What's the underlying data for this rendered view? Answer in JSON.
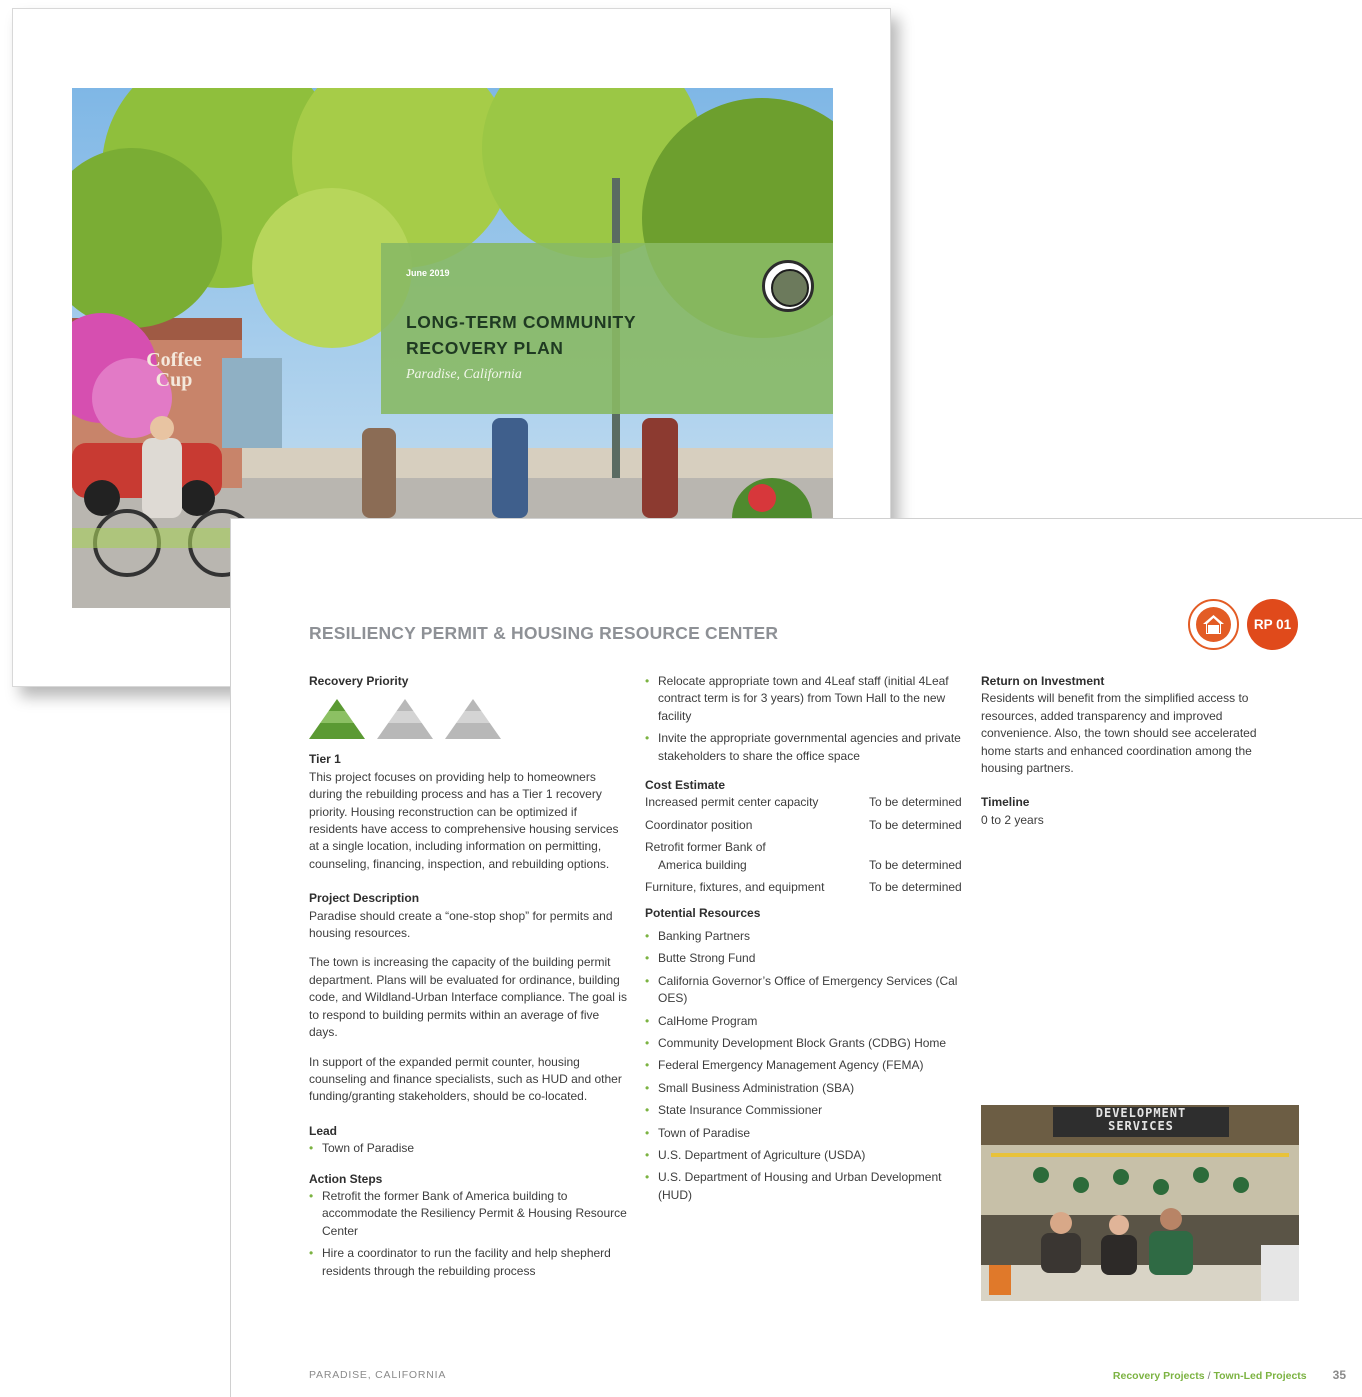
{
  "cover": {
    "date": "June 2019",
    "title_line1": "LONG-TERM COMMUNITY",
    "title_line2": "RECOVERY PLAN",
    "subtitle": "Paradise, California",
    "sign_text": "Coffee Cup"
  },
  "page": {
    "title": "RESILIENCY PERMIT & HOUSING RESOURCE CENTER",
    "badge_code": "RP 01",
    "badge_icon": "house-icon",
    "accent_color": "#e04a1b",
    "green_color": "#7cb342",
    "recovery_priority": {
      "heading": "Recovery Priority",
      "level": 1,
      "of": 3,
      "tier_label": "Tier 1",
      "tier_text": "This project focuses on providing help to homeowners during the rebuilding process and has a Tier 1 recovery priority. Housing reconstruction can be optimized if residents have access to comprehensive housing services at a single location, including information on permitting, counseling, financing, inspection, and rebuilding options."
    },
    "project_description": {
      "heading": "Project Description",
      "paragraphs": [
        "Paradise should create a “one-stop shop” for permits and housing resources.",
        "The town is increasing the capacity of the building permit department. Plans will be evaluated for ordinance, building code, and Wildland-Urban Interface compliance. The goal is to respond to building permits within an average of five days.",
        "In support of the expanded permit counter, housing counseling and finance specialists, such as HUD and other funding/granting stakeholders, should be co-located."
      ]
    },
    "lead": {
      "heading": "Lead",
      "items": [
        "Town of Paradise"
      ]
    },
    "action_steps": {
      "heading": "Action Steps",
      "items": [
        "Retrofit the former Bank of America building to accommodate the Resiliency Permit & Housing Resource Center",
        "Hire a coordinator to run the facility and help shepherd residents through the rebuilding process",
        "Relocate appropriate town and 4Leaf staff (initial 4Leaf contract term is for 3 years) from Town Hall to the new facility",
        "Invite the appropriate governmental agencies and private stakeholders to share the office space"
      ]
    },
    "cost_estimate": {
      "heading": "Cost Estimate",
      "rows": [
        {
          "item": "Increased permit center capacity",
          "value": "To be determined"
        },
        {
          "item": "Coordinator position",
          "value": "To be determined"
        },
        {
          "item": "Retrofit former Bank of",
          "item2": "America building",
          "value": "To be determined"
        },
        {
          "item": "Furniture, fixtures, and equipment",
          "value": "To be determined"
        }
      ]
    },
    "potential_resources": {
      "heading": "Potential Resources",
      "items": [
        "Banking Partners",
        "Butte Strong Fund",
        "California Governor’s Office of Emergency Services (Cal OES)",
        "CalHome Program",
        "Community Development Block Grants (CDBG) Home",
        "Federal Emergency Management Agency (FEMA)",
        "Small Business Administration (SBA)",
        "State Insurance Commissioner",
        "Town of Paradise",
        "U.S. Department of Agriculture (USDA)",
        "U.S. Department of Housing and Urban Development (HUD)"
      ]
    },
    "return_on_investment": {
      "heading": "Return on Investment",
      "text": "Residents will benefit from the simplified access to resources, added transparency and improved convenience. Also, the town should see accelerated home starts and enhanced coordination among the housing partners."
    },
    "timeline": {
      "heading": "Timeline",
      "text": "0 to 2 years"
    },
    "photo_sign": "DEVELOPMENT SERVICES",
    "footer": {
      "left": "PARADISE, CALIFORNIA",
      "crumb1": "Recovery Projects",
      "sep": "/",
      "crumb2": "Town-Led Projects",
      "page_number": "35"
    }
  }
}
